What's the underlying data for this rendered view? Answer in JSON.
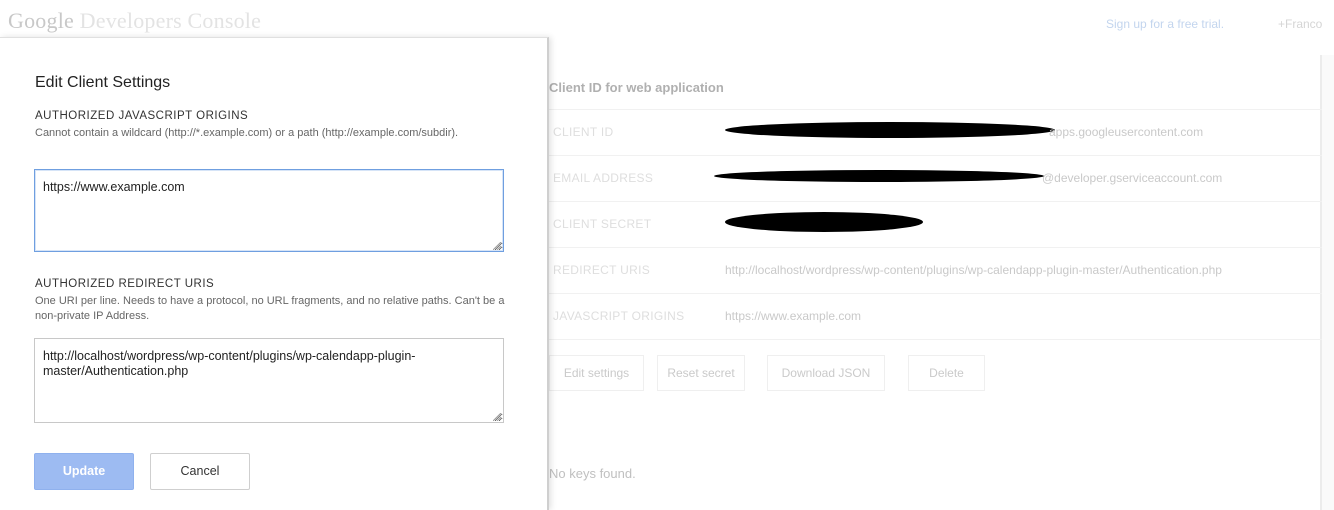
{
  "header": {
    "logo_word1": "Google",
    "logo_word2": "Developers Console",
    "signup_link": "Sign up for a free trial.",
    "user_link": "+Franco"
  },
  "background": {
    "section_title": "Client ID for web application",
    "rows": [
      {
        "label": "CLIENT ID",
        "value": "apps.googleusercontent.com"
      },
      {
        "label": "EMAIL ADDRESS",
        "value": "@developer.gserviceaccount.com"
      },
      {
        "label": "CLIENT SECRET",
        "value": ""
      },
      {
        "label": "REDIRECT URIS",
        "value": "http://localhost/wordpress/wp-content/plugins/wp-calendapp-plugin-master/Authentication.php"
      },
      {
        "label": "JAVASCRIPT ORIGINS",
        "value": "https://www.example.com"
      }
    ],
    "buttons": {
      "edit": "Edit settings",
      "reset": "Reset secret",
      "download": "Download JSON",
      "delete": "Delete"
    },
    "no_keys": "No keys found."
  },
  "dialog": {
    "title": "Edit Client Settings",
    "origins": {
      "heading": "AUTHORIZED JAVASCRIPT ORIGINS",
      "description": "Cannot contain a wildcard (http://*.example.com) or a path (http://example.com/subdir).",
      "value": "https://www.example.com"
    },
    "redirects": {
      "heading": "AUTHORIZED REDIRECT URIS",
      "description": "One URI per line. Needs to have a protocol, no URL fragments, and no relative paths. Can't be a non-private IP Address.",
      "value": "http://localhost/wordpress/wp-content/plugins/wp-calendapp-plugin-master/Authentication.php"
    },
    "update_label": "Update",
    "cancel_label": "Cancel"
  },
  "colors": {
    "primary_button": "#9dbbf2",
    "focus_border": "#6f9fe0",
    "link": "#c3d5ee"
  }
}
